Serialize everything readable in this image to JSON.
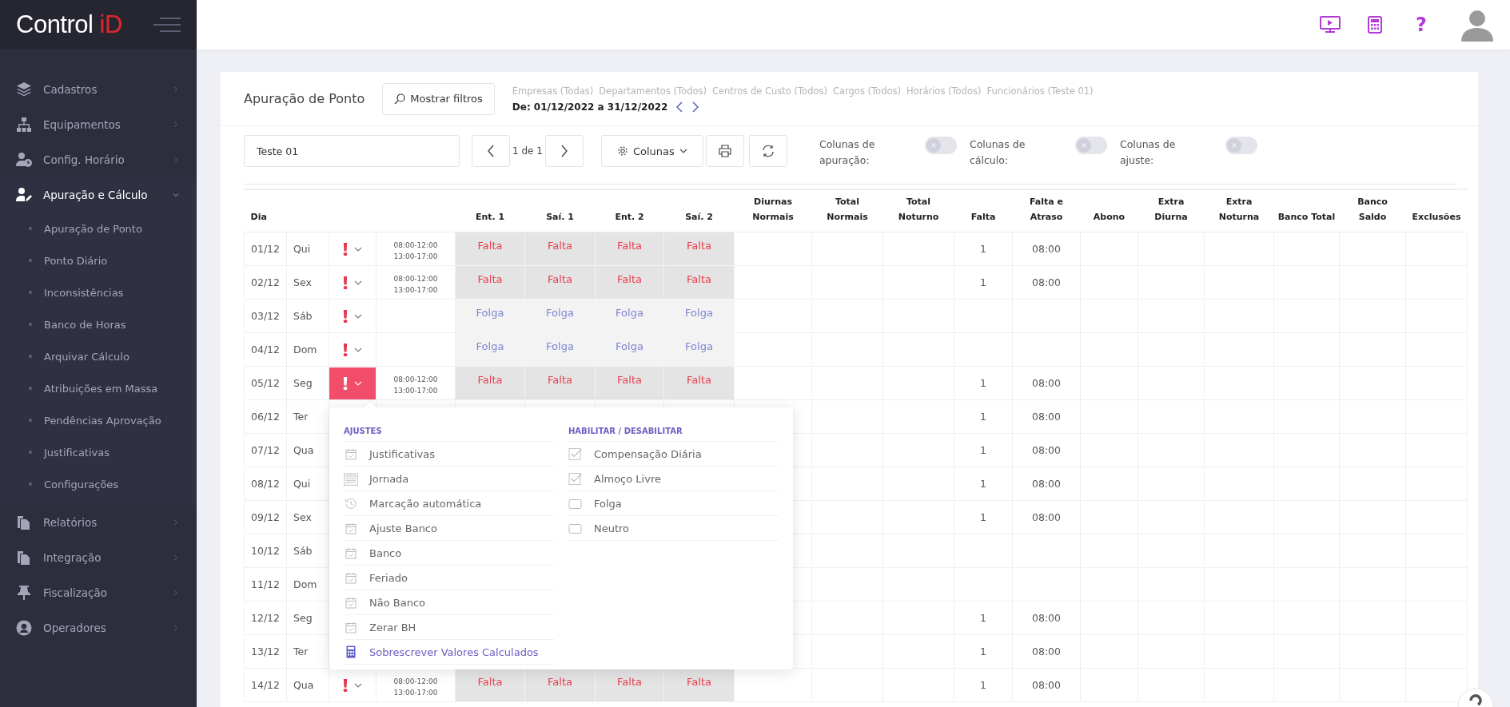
{
  "logo": {
    "text": "Control",
    "accent": "iD"
  },
  "sidebar": {
    "items": [
      {
        "label": "Cadastros",
        "expanded": false
      },
      {
        "label": "Equipamentos",
        "expanded": false
      },
      {
        "label": "Config. Horário",
        "expanded": false
      },
      {
        "label": "Apuração e Cálculo",
        "expanded": true,
        "children": [
          {
            "label": "Apuração de Ponto"
          },
          {
            "label": "Ponto Diário"
          },
          {
            "label": "Inconsistências"
          },
          {
            "label": "Banco de Horas"
          },
          {
            "label": "Arquivar Cálculo"
          },
          {
            "label": "Atribuições em Massa"
          },
          {
            "label": "Pendências Aprovação"
          },
          {
            "label": "Justificativas"
          },
          {
            "label": "Configurações"
          }
        ]
      },
      {
        "label": "Relatórios",
        "expanded": false
      },
      {
        "label": "Integração",
        "expanded": false
      },
      {
        "label": "Fiscalização",
        "expanded": false
      },
      {
        "label": "Operadores",
        "expanded": false
      }
    ]
  },
  "topbar": {
    "help": "?"
  },
  "card": {
    "title": "Apuração de Ponto",
    "filter_button": "Mostrar filtros",
    "filters": [
      "Empresas (Todas)",
      "Departamentos (Todos)",
      "Centros de Custo (Todos)",
      "Cargos (Todos)",
      "Horários (Todos)",
      "Funcionários (Teste 01)"
    ],
    "period": "De: 01/12/2022 a 31/12/2022"
  },
  "toolbar": {
    "employee": "Teste 01",
    "page": "1 de 1",
    "columns_button": "Colunas",
    "toggles": [
      {
        "label": "Colunas de apuração:",
        "on": false
      },
      {
        "label": "Colunas de cálculo:",
        "on": false
      },
      {
        "label": "Colunas de ajuste:",
        "on": false
      }
    ]
  },
  "table": {
    "columns": [
      "Dia",
      "Ent. 1",
      "Saí. 1",
      "Ent. 2",
      "Saí. 2",
      "Diurnas Normais",
      "Total Normais",
      "Total Noturno",
      "Falta",
      "Falta e Atraso",
      "Abono",
      "Extra Diurna",
      "Extra Noturna",
      "Banco Total",
      "Banco Saldo",
      "Exclusões"
    ],
    "rows": [
      {
        "date": "01/12",
        "weekday": "Qui",
        "alert": true,
        "menu_open": false,
        "schedule": [
          "08:00-12:00",
          "13:00-17:00"
        ],
        "punches": [
          {
            "text": "Falta",
            "kind": "absence"
          },
          {
            "text": "Falta",
            "kind": "absence"
          },
          {
            "text": "Falta",
            "kind": "absence"
          },
          {
            "text": "Falta",
            "kind": "absence"
          }
        ],
        "falta": "1",
        "falta_atraso": "08:00"
      },
      {
        "date": "02/12",
        "weekday": "Sex",
        "alert": true,
        "menu_open": false,
        "schedule": [
          "08:00-12:00",
          "13:00-17:00"
        ],
        "punches": [
          {
            "text": "Falta",
            "kind": "absence"
          },
          {
            "text": "Falta",
            "kind": "absence"
          },
          {
            "text": "Falta",
            "kind": "absence"
          },
          {
            "text": "Falta",
            "kind": "absence"
          }
        ],
        "falta": "1",
        "falta_atraso": "08:00"
      },
      {
        "date": "03/12",
        "weekday": "Sáb",
        "alert": true,
        "menu_open": false,
        "punches": [
          {
            "text": "Folga",
            "kind": "dayoff"
          },
          {
            "text": "Folga",
            "kind": "dayoff"
          },
          {
            "text": "Folga",
            "kind": "dayoff"
          },
          {
            "text": "Folga",
            "kind": "dayoff"
          }
        ]
      },
      {
        "date": "04/12",
        "weekday": "Dom",
        "alert": true,
        "menu_open": false,
        "punches": [
          {
            "text": "Folga",
            "kind": "dayoff"
          },
          {
            "text": "Folga",
            "kind": "dayoff"
          },
          {
            "text": "Folga",
            "kind": "dayoff"
          },
          {
            "text": "Folga",
            "kind": "dayoff"
          }
        ]
      },
      {
        "date": "05/12",
        "weekday": "Seg",
        "alert": true,
        "menu_open": true,
        "schedule": [
          "08:00-12:00",
          "13:00-17:00"
        ],
        "punches": [
          {
            "text": "Falta",
            "kind": "absence"
          },
          {
            "text": "Falta",
            "kind": "absence"
          },
          {
            "text": "Falta",
            "kind": "absence"
          },
          {
            "text": "Falta",
            "kind": "absence"
          }
        ],
        "falta": "1",
        "falta_atraso": "08:00"
      },
      {
        "date": "06/12",
        "weekday": "Ter",
        "falta": "1",
        "falta_atraso": "08:00"
      },
      {
        "date": "07/12",
        "weekday": "Qua",
        "falta": "1",
        "falta_atraso": "08:00"
      },
      {
        "date": "08/12",
        "weekday": "Qui",
        "falta": "1",
        "falta_atraso": "08:00"
      },
      {
        "date": "09/12",
        "weekday": "Sex",
        "falta": "1",
        "falta_atraso": "08:00"
      },
      {
        "date": "10/12",
        "weekday": "Sáb"
      },
      {
        "date": "11/12",
        "weekday": "Dom"
      },
      {
        "date": "12/12",
        "weekday": "Seg",
        "falta": "1",
        "falta_atraso": "08:00"
      },
      {
        "date": "13/12",
        "weekday": "Ter",
        "falta": "1",
        "falta_atraso": "08:00"
      },
      {
        "date": "14/12",
        "weekday": "Qua",
        "alert": true,
        "menu_open": false,
        "schedule": [
          "08:00-12:00",
          "13:00-17:00"
        ],
        "punches": [
          {
            "text": "Falta",
            "kind": "absence"
          },
          {
            "text": "Falta",
            "kind": "absence"
          },
          {
            "text": "Falta",
            "kind": "absence"
          },
          {
            "text": "Falta",
            "kind": "absence"
          }
        ],
        "falta": "1",
        "falta_atraso": "08:00"
      }
    ]
  },
  "popup": {
    "left_title": "AJUSTES",
    "left_items": [
      {
        "label": "Justificativas",
        "kind": "calendar-check"
      },
      {
        "label": "Jornada",
        "kind": "calendar"
      },
      {
        "label": "Marcação automática",
        "kind": "history"
      },
      {
        "label": "Ajuste Banco",
        "kind": "calendar-check"
      },
      {
        "label": "Banco",
        "kind": "calendar-check"
      },
      {
        "label": "Feriado",
        "kind": "calendar-check"
      },
      {
        "label": "Não Banco",
        "kind": "calendar-check"
      },
      {
        "label": "Zerar BH",
        "kind": "calendar-check"
      },
      {
        "label": "Sobrescrever Valores Calculados",
        "kind": "calculator"
      }
    ],
    "right_title": "HABILITAR / DESABILITAR",
    "right_items": [
      {
        "label": "Compensação Diária",
        "checked": true
      },
      {
        "label": "Almoço Livre",
        "checked": true
      },
      {
        "label": "Folga",
        "checked": false
      },
      {
        "label": "Neutro",
        "checked": false
      }
    ]
  }
}
